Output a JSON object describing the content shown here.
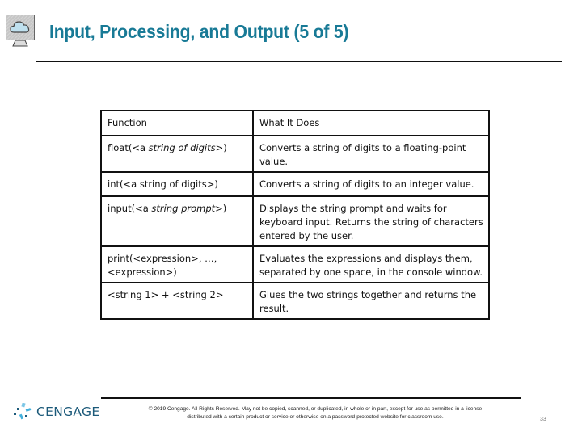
{
  "slide": {
    "title": "Input, Processing, and Output (5 of 5)",
    "title_color": "#187a96",
    "header_icon": "computer-monitor-cloud-icon"
  },
  "table": {
    "headers": [
      "Function",
      "What It Does"
    ],
    "rows": [
      {
        "function_name": "float",
        "function_pre": "(<a ",
        "function_italic": "string of digits",
        "function_post": ">)",
        "description": "Converts a string of digits to a floating-point value."
      },
      {
        "function_name": "int",
        "function_pre": "(<a string of digits>)",
        "function_italic": "",
        "function_post": "",
        "description": "Converts a string of digits to an integer value."
      },
      {
        "function_name": "input",
        "function_pre": "(<a ",
        "function_italic": "string prompt",
        "function_post": ">)",
        "description": "Displays the string prompt and waits for keyboard input. Returns the string of characters entered by the user."
      },
      {
        "function_name": "print",
        "function_pre": "(<expression>, …,<expression>)",
        "function_italic": "",
        "function_post": "",
        "description": "Evaluates the expressions and displays them, separated by one space, in the console window."
      },
      {
        "function_name": "",
        "function_pre": "<string 1> + <string 2>",
        "function_italic": "",
        "function_post": "",
        "description": "Glues the two strings together and returns the result."
      }
    ]
  },
  "footer": {
    "logo_text": "CENGAGE",
    "logo_icon": "cengage-logo-icon",
    "copyright_line1": "© 2019 Cengage. All Rights Reserved. May not be copied, scanned, or duplicated, in whole or in part, except for use as permitted in a license",
    "copyright_line2": "distributed with a certain product or service or otherwise on a password-protected website for classroom use.",
    "page_number": "33"
  }
}
